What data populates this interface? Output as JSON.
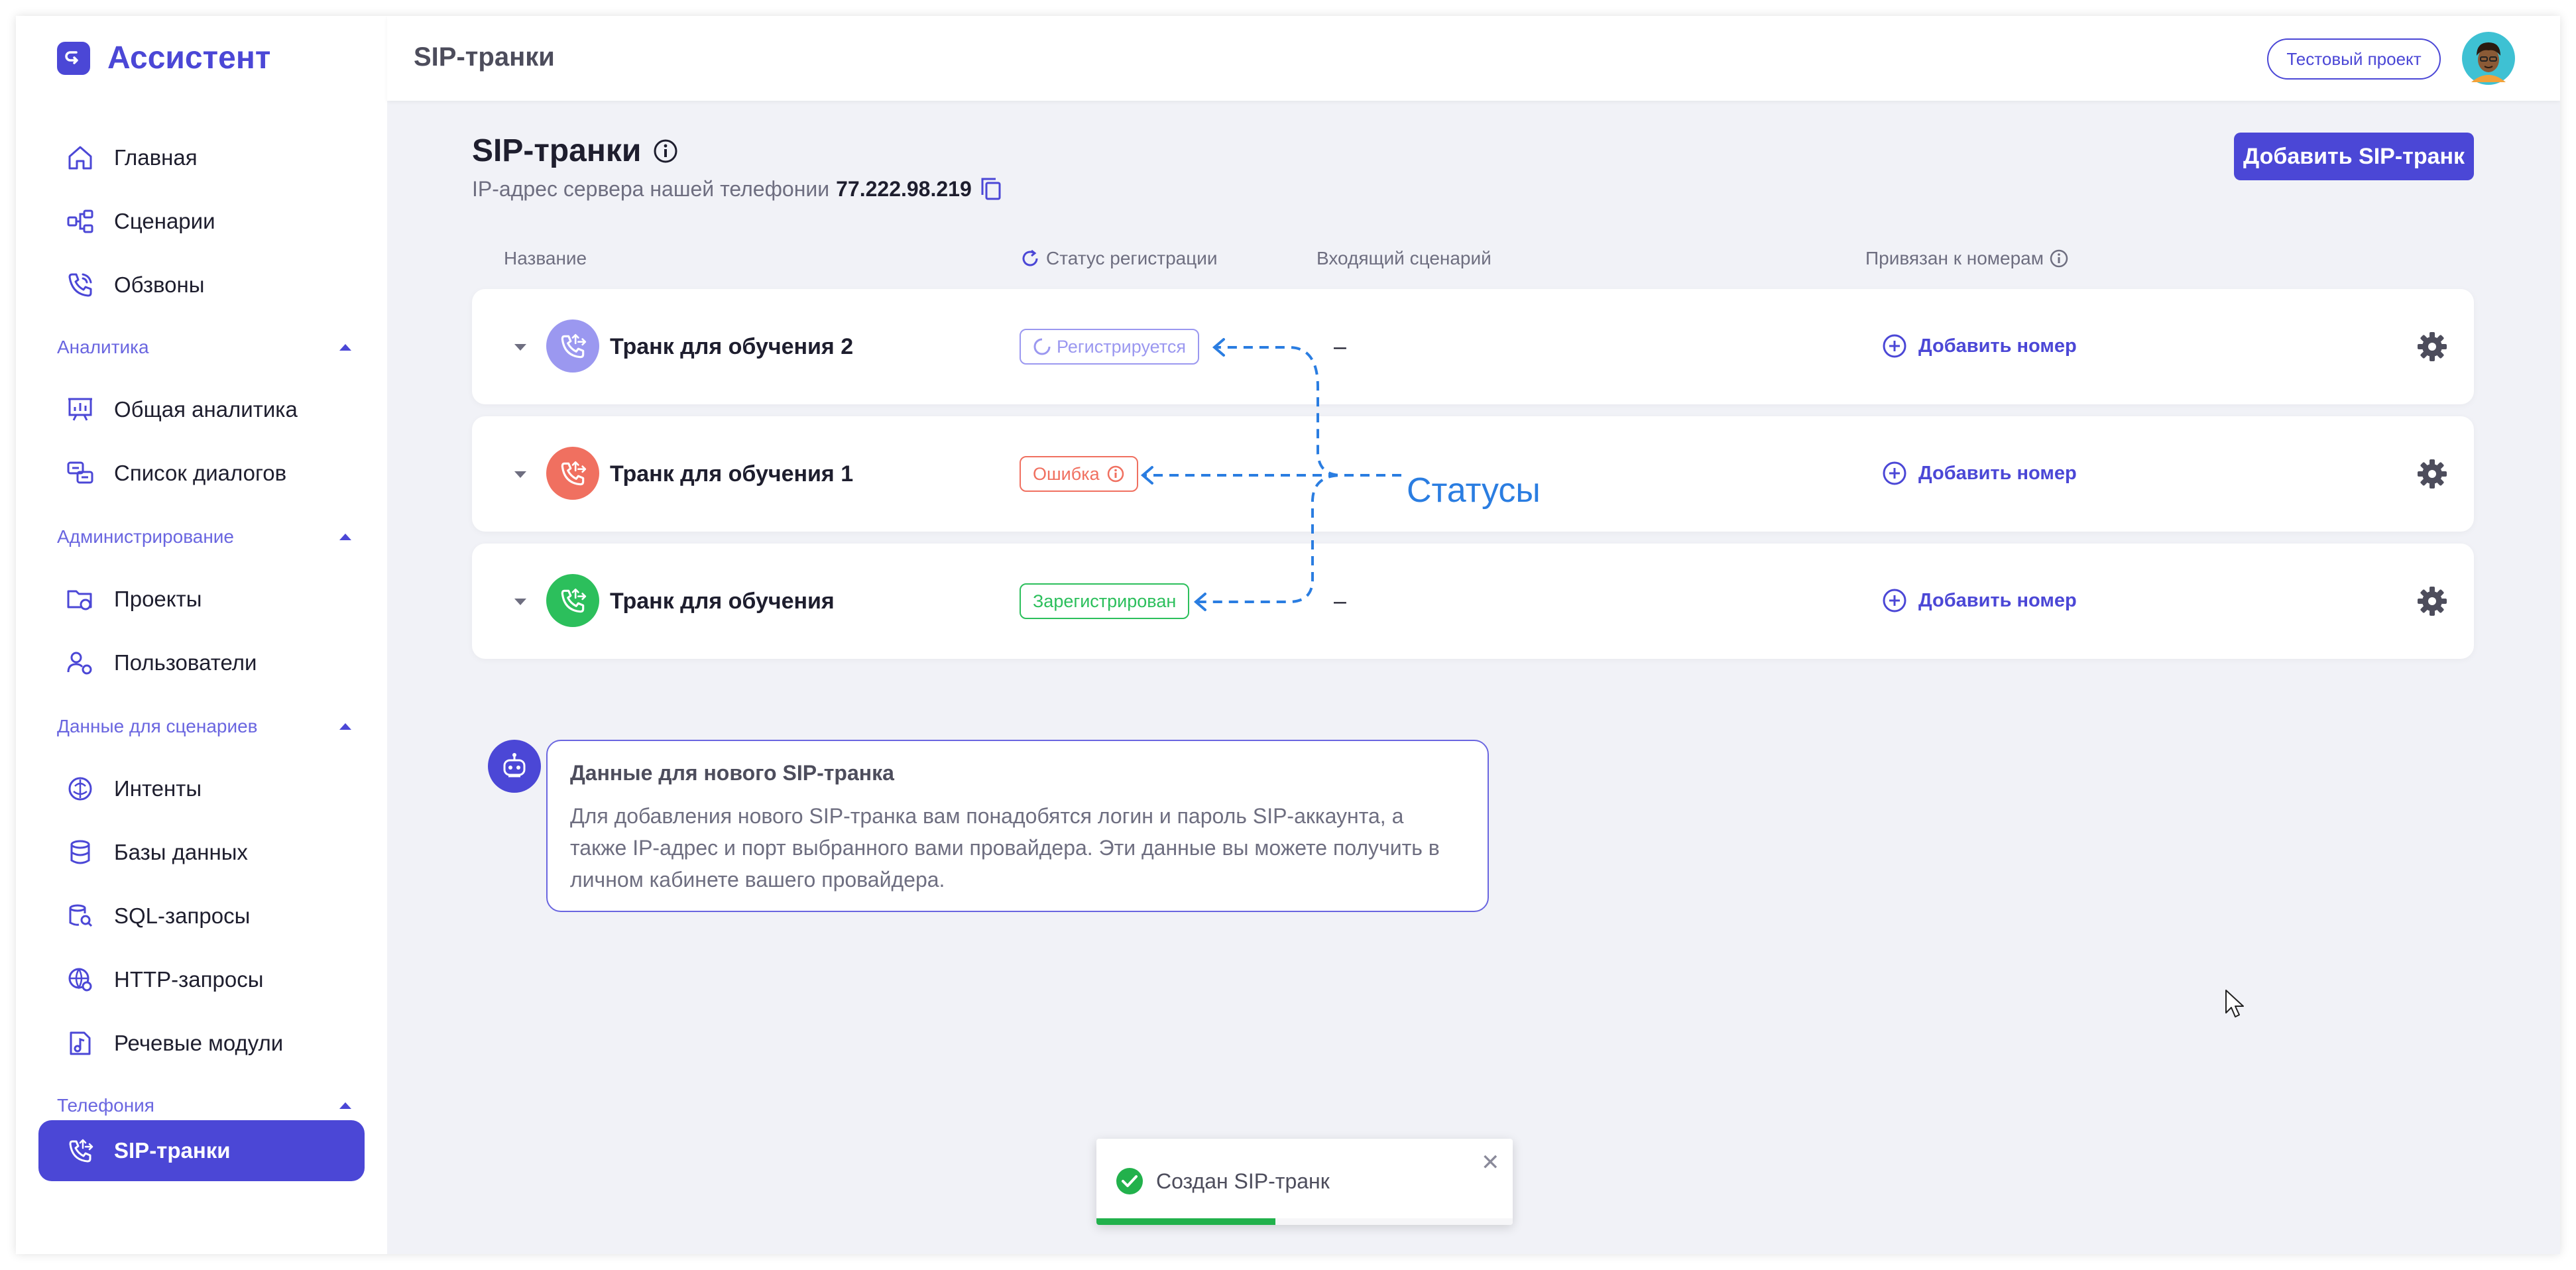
{
  "app": {
    "name": "Ассистент"
  },
  "header": {
    "title": "SIP-транки",
    "project_label": "Тестовый проект"
  },
  "sidebar": {
    "top_items": [
      {
        "label": "Главная",
        "icon": "home-icon"
      },
      {
        "label": "Сценарии",
        "icon": "scenarios-icon"
      },
      {
        "label": "Обзвоны",
        "icon": "phone-calls-icon"
      }
    ],
    "sections": [
      {
        "title": "Аналитика",
        "items": [
          {
            "label": "Общая аналитика",
            "icon": "analytics-icon"
          },
          {
            "label": "Список диалогов",
            "icon": "dialogs-icon"
          }
        ]
      },
      {
        "title": "Администрирование",
        "items": [
          {
            "label": "Проекты",
            "icon": "projects-icon"
          },
          {
            "label": "Пользователи",
            "icon": "users-icon"
          }
        ]
      },
      {
        "title": "Данные для сценариев",
        "items": [
          {
            "label": "Интенты",
            "icon": "intents-icon"
          },
          {
            "label": "Базы данных",
            "icon": "database-icon"
          },
          {
            "label": "SQL-запросы",
            "icon": "sql-icon"
          },
          {
            "label": "HTTP-запросы",
            "icon": "http-icon"
          },
          {
            "label": "Речевые модули",
            "icon": "speech-icon"
          }
        ]
      },
      {
        "title": "Телефония",
        "items": [
          {
            "label": "SIP-транки",
            "icon": "sip-trunk-icon",
            "active": true
          }
        ]
      }
    ]
  },
  "main": {
    "title": "SIP-транки",
    "ip_label": "IP-адрес сервера нашей телефонии",
    "ip_value": "77.222.98.219",
    "add_button": "Добавить SIP-транк",
    "columns": {
      "name": "Название",
      "status": "Статус регистрации",
      "incoming": "Входящий сценарий",
      "linked": "Привязан к номерам"
    },
    "trunks": [
      {
        "name": "Транк для обучения 2",
        "status": "Регистрируется",
        "status_type": "pending",
        "incoming": "–",
        "add_number": "Добавить номер"
      },
      {
        "name": "Транк для обучения 1",
        "status": "Ошибка",
        "status_type": "error",
        "incoming": "",
        "add_number": "Добавить номер"
      },
      {
        "name": "Транк для обучения",
        "status": "Зарегистрирован",
        "status_type": "ok",
        "incoming": "–",
        "add_number": "Добавить номер"
      }
    ],
    "annotation": "Статусы",
    "info_card": {
      "title": "Данные для нового SIP-транка",
      "text": "Для добавления нового SIP-транка вам понадобятся логин и пароль SIP-аккаунта, а также IP-адрес и порт выбранного вами провайдера. Эти данные вы можете получить в личном кабинете вашего провайдера."
    }
  },
  "toast": {
    "text": "Создан SIP-транк",
    "progress": 0.43
  },
  "colors": {
    "accent": "#4b47d6",
    "pending": "#9b98f0",
    "error": "#f07060",
    "ok": "#2cbf5c",
    "annotation": "#2a7de1"
  }
}
